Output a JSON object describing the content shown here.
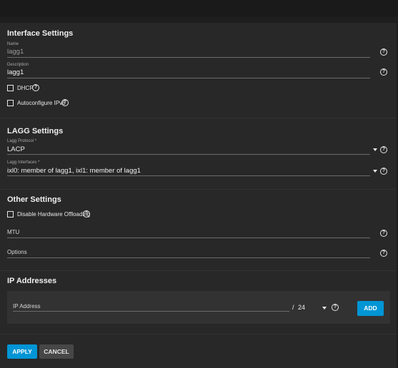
{
  "interface_settings": {
    "title": "Interface Settings",
    "name": {
      "label": "Name",
      "value": "lagg1"
    },
    "description": {
      "label": "Description",
      "value": "lagg1"
    },
    "dhcp": {
      "label": "DHCP",
      "checked": false
    },
    "autoconfigure_ipv6": {
      "label": "Autoconfigure IPv6",
      "checked": false
    }
  },
  "lagg_settings": {
    "title": "LAGG Settings",
    "protocol": {
      "label": "Lagg Protocol *",
      "value": "LACP"
    },
    "interfaces": {
      "label": "Lagg Interfaces *",
      "value": "ixl0: member of lagg1, ixl1: member of lagg1"
    }
  },
  "other_settings": {
    "title": "Other Settings",
    "disable_hw_offloading": {
      "label": "Disable Hardware Offloading",
      "checked": false
    },
    "mtu": {
      "label": "MTU",
      "value": ""
    },
    "options": {
      "label": "Options",
      "value": ""
    }
  },
  "ip_addresses": {
    "title": "IP Addresses",
    "ip_label": "IP Address",
    "separator": "/",
    "netmask": "24",
    "add_label": "ADD"
  },
  "actions": {
    "apply_label": "APPLY",
    "cancel_label": "CANCEL"
  },
  "icons": {
    "help": "help-circle-icon",
    "dropdown": "caret-down-icon",
    "checkbox": "checkbox-unchecked-icon"
  },
  "colors": {
    "accent": "#0095d5",
    "panel": "#282828",
    "background": "#1e1e1e"
  }
}
